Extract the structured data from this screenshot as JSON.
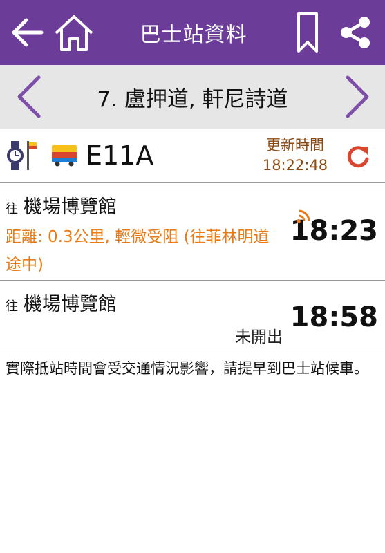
{
  "header": {
    "title": "巴士站資料",
    "icons": {
      "back": "arrow-left-icon",
      "home": "home-icon",
      "bookmark": "bookmark-icon",
      "share": "share-icon"
    },
    "color": "#6b3d98"
  },
  "stop": {
    "name": "7. 盧押道, 軒尼詩道",
    "prev_icon": "chevron-left-icon",
    "next_icon": "chevron-right-icon"
  },
  "route": {
    "number": "E11A",
    "update_label": "更新時間",
    "update_time": "18:22:48",
    "icons": {
      "watch": "watch-icon",
      "stop_sign": "bus-stop-icon",
      "bus": "bus-icon",
      "refresh": "refresh-icon"
    }
  },
  "etas": [
    {
      "prefix": "往",
      "destination": "機場博覽館",
      "info": "距離: 0.3公里, 輕微受阻 (往菲林明道 途中)",
      "time": "18:23",
      "status": ""
    },
    {
      "prefix": "往",
      "destination": "機場博覽館",
      "info": "",
      "time": "18:58",
      "status": "未開出"
    }
  ],
  "note": "實際抵站時間會受交通情況影響，請提早到巴士站候車。",
  "colors": {
    "accent": "#6b3d98",
    "warning": "#ea7a16",
    "refresh": "#d9452f",
    "update_text": "#8a4a12"
  }
}
